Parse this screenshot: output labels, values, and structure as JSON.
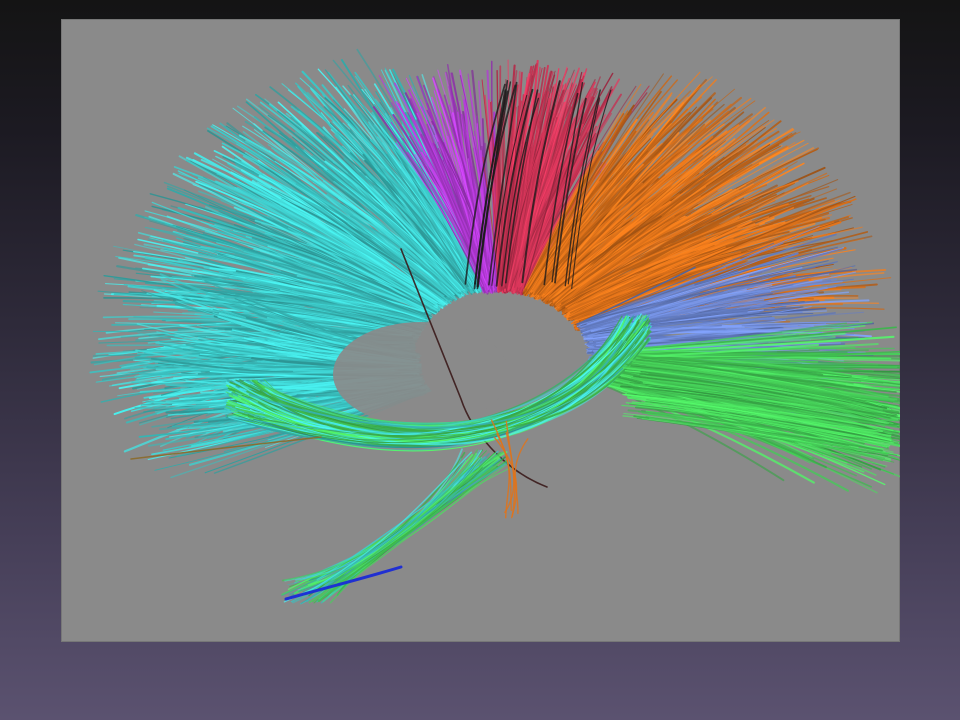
{
  "figure": {
    "background_color": "#8a8a8a",
    "bundles": [
      {
        "name": "cyan-fibers",
        "color": "#3fd1d0"
      },
      {
        "name": "magenta-fibers",
        "color": "#b43ad8"
      },
      {
        "name": "red-fibers",
        "color": "#d8365a"
      },
      {
        "name": "orange-fibers",
        "color": "#e0731a"
      },
      {
        "name": "blue-fibers",
        "color": "#6f8bd9"
      },
      {
        "name": "green-fibers",
        "color": "#47d35a"
      },
      {
        "name": "dark-fibers",
        "color": "#1a1a1a"
      }
    ]
  }
}
